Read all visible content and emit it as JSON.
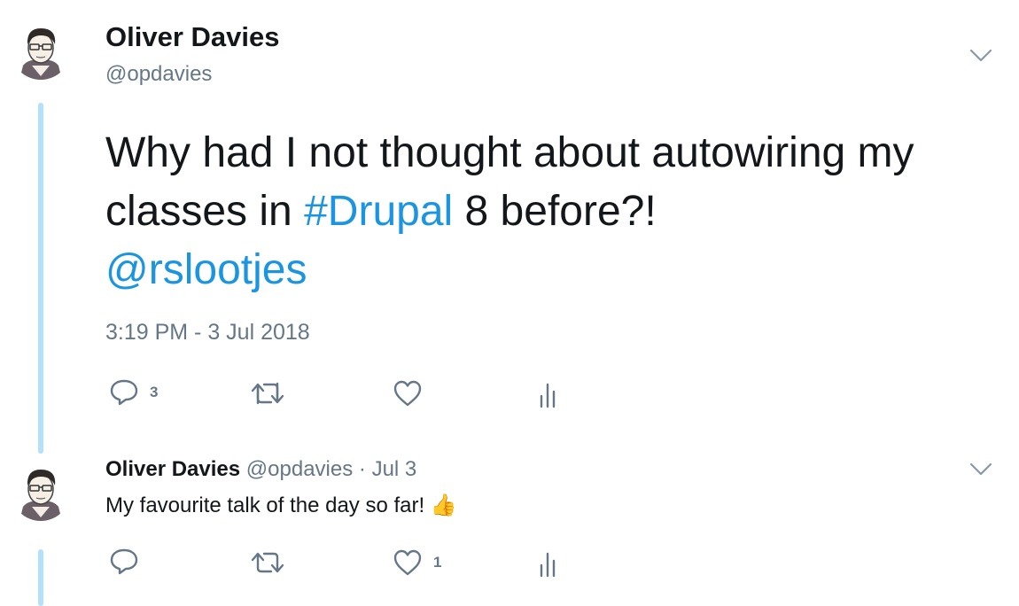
{
  "main_tweet": {
    "author_name": "Oliver Davies",
    "author_handle": "@opdavies",
    "text_plain_1": "Why had I not thought about autowiring my classes in ",
    "hashtag": "#Drupal",
    "text_plain_2": " 8 before?!",
    "mention": "@rslootjes",
    "timestamp": "3:19 PM - 3 Jul 2018",
    "actions": {
      "reply_count": "3",
      "retweet_count": "",
      "like_count": ""
    }
  },
  "reply_tweet": {
    "author_name": "Oliver Davies",
    "author_handle": "@opdavies",
    "separator": "·",
    "date": "Jul 3",
    "text": "My favourite talk of the day so far!",
    "emoji": "👍",
    "actions": {
      "reply_count": "",
      "retweet_count": "",
      "like_count": "1"
    }
  },
  "icons": {
    "reply": "reply-icon",
    "retweet": "retweet-icon",
    "like": "heart-icon",
    "analytics": "analytics-icon",
    "menu": "chevron-down-icon"
  },
  "colors": {
    "link": "#1b95e0",
    "muted": "#657786",
    "thread_line": "#b3e0fa",
    "text": "#14171a"
  }
}
